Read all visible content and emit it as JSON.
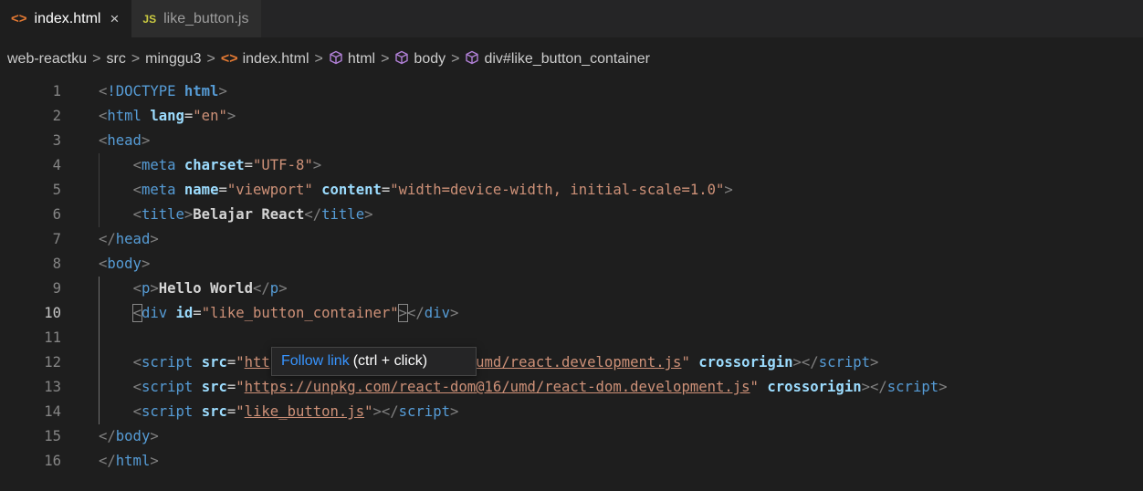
{
  "tabs": [
    {
      "icon": "<>",
      "label": "index.html",
      "close": "×",
      "active": true
    },
    {
      "icon": "JS",
      "label": "like_button.js",
      "active": false
    }
  ],
  "breadcrumb": {
    "items": [
      "web-reactku",
      "src",
      "minggu3",
      "index.html",
      "html",
      "body",
      "div#like_button_container"
    ],
    "separator": ">"
  },
  "editor": {
    "current_line": 10,
    "lines": [
      {
        "n": "1",
        "tokens": [
          [
            "p",
            "<"
          ],
          [
            "t",
            "!DOCTYPE"
          ],
          [
            "x",
            " "
          ],
          [
            "b",
            "html"
          ],
          [
            "p",
            ">"
          ]
        ]
      },
      {
        "n": "2",
        "tokens": [
          [
            "p",
            "<"
          ],
          [
            "t",
            "html"
          ],
          [
            "x",
            " "
          ],
          [
            "ab",
            "lang"
          ],
          [
            "x",
            "="
          ],
          [
            "s",
            "\"en\""
          ],
          [
            "p",
            ">"
          ]
        ]
      },
      {
        "n": "3",
        "tokens": [
          [
            "p",
            "<"
          ],
          [
            "t",
            "head"
          ],
          [
            "p",
            ">"
          ]
        ]
      },
      {
        "n": "4",
        "tokens": [
          [
            "x",
            "    "
          ],
          [
            "p",
            "<"
          ],
          [
            "t",
            "meta"
          ],
          [
            "x",
            " "
          ],
          [
            "ab",
            "charset"
          ],
          [
            "x",
            "="
          ],
          [
            "s",
            "\"UTF-8\""
          ],
          [
            "p",
            ">"
          ]
        ]
      },
      {
        "n": "5",
        "tokens": [
          [
            "x",
            "    "
          ],
          [
            "p",
            "<"
          ],
          [
            "t",
            "meta"
          ],
          [
            "x",
            " "
          ],
          [
            "ab",
            "name"
          ],
          [
            "x",
            "="
          ],
          [
            "s",
            "\"viewport\""
          ],
          [
            "x",
            " "
          ],
          [
            "ab",
            "content"
          ],
          [
            "x",
            "="
          ],
          [
            "s",
            "\"width=device-width, initial-scale=1.0\""
          ],
          [
            "p",
            ">"
          ]
        ]
      },
      {
        "n": "6",
        "tokens": [
          [
            "x",
            "    "
          ],
          [
            "p",
            "<"
          ],
          [
            "t",
            "title"
          ],
          [
            "p",
            ">"
          ],
          [
            "xb",
            "Belajar React"
          ],
          [
            "p",
            "</"
          ],
          [
            "t",
            "title"
          ],
          [
            "p",
            ">"
          ]
        ]
      },
      {
        "n": "7",
        "tokens": [
          [
            "p",
            "</"
          ],
          [
            "t",
            "head"
          ],
          [
            "p",
            ">"
          ]
        ]
      },
      {
        "n": "8",
        "tokens": [
          [
            "p",
            "<"
          ],
          [
            "t",
            "body"
          ],
          [
            "p",
            ">"
          ]
        ]
      },
      {
        "n": "9",
        "tokens": [
          [
            "x",
            "    "
          ],
          [
            "p",
            "<"
          ],
          [
            "t",
            "p"
          ],
          [
            "p",
            ">"
          ],
          [
            "xb",
            "Hello World"
          ],
          [
            "p",
            "</"
          ],
          [
            "t",
            "p"
          ],
          [
            "p",
            ">"
          ]
        ]
      },
      {
        "n": "10",
        "tokens": [
          [
            "x",
            "    "
          ],
          [
            "pb",
            "<"
          ],
          [
            "t",
            "div"
          ],
          [
            "x",
            " "
          ],
          [
            "ab",
            "id"
          ],
          [
            "x",
            "="
          ],
          [
            "s",
            "\"like_button_container\""
          ],
          [
            "pb",
            ">"
          ],
          [
            "p",
            "</"
          ],
          [
            "t",
            "div"
          ],
          [
            "p",
            ">"
          ]
        ]
      },
      {
        "n": "11",
        "tokens": []
      },
      {
        "n": "12",
        "tokens": [
          [
            "x",
            "    "
          ],
          [
            "p",
            "<"
          ],
          [
            "t",
            "script"
          ],
          [
            "x",
            " "
          ],
          [
            "ab",
            "src"
          ],
          [
            "x",
            "="
          ],
          [
            "s",
            "\""
          ],
          [
            "l",
            "https://unpkg.com/react@16/umd/react.development.js"
          ],
          [
            "s",
            "\""
          ],
          [
            "x",
            " "
          ],
          [
            "ab",
            "crossorigin"
          ],
          [
            "p",
            "></"
          ],
          [
            "t",
            "script"
          ],
          [
            "p",
            ">"
          ]
        ]
      },
      {
        "n": "13",
        "tokens": [
          [
            "x",
            "    "
          ],
          [
            "p",
            "<"
          ],
          [
            "t",
            "script"
          ],
          [
            "x",
            " "
          ],
          [
            "ab",
            "src"
          ],
          [
            "x",
            "="
          ],
          [
            "s",
            "\""
          ],
          [
            "l",
            "https://unpkg.com/react-dom@16/umd/react-dom.development.js"
          ],
          [
            "s",
            "\""
          ],
          [
            "x",
            " "
          ],
          [
            "ab",
            "crossorigin"
          ],
          [
            "p",
            "></"
          ],
          [
            "t",
            "script"
          ],
          [
            "p",
            ">"
          ]
        ]
      },
      {
        "n": "14",
        "tokens": [
          [
            "x",
            "    "
          ],
          [
            "p",
            "<"
          ],
          [
            "t",
            "script"
          ],
          [
            "x",
            " "
          ],
          [
            "ab",
            "src"
          ],
          [
            "x",
            "="
          ],
          [
            "s",
            "\""
          ],
          [
            "l",
            "like_button.js"
          ],
          [
            "s",
            "\""
          ],
          [
            "p",
            "></"
          ],
          [
            "t",
            "script"
          ],
          [
            "p",
            ">"
          ]
        ]
      },
      {
        "n": "15",
        "tokens": [
          [
            "p",
            "</"
          ],
          [
            "t",
            "body"
          ],
          [
            "p",
            ">"
          ]
        ]
      },
      {
        "n": "16",
        "tokens": [
          [
            "p",
            "</"
          ],
          [
            "t",
            "html"
          ],
          [
            "p",
            ">"
          ]
        ]
      }
    ]
  },
  "tooltip": {
    "link": "Follow link",
    "hint": "(ctrl + click)"
  },
  "colors": {
    "background": "#1e1e1e",
    "tag": "#569cd6",
    "attribute": "#9cdcfe",
    "string": "#ce9178",
    "punctuation": "#808080",
    "link": "#3794ff"
  }
}
